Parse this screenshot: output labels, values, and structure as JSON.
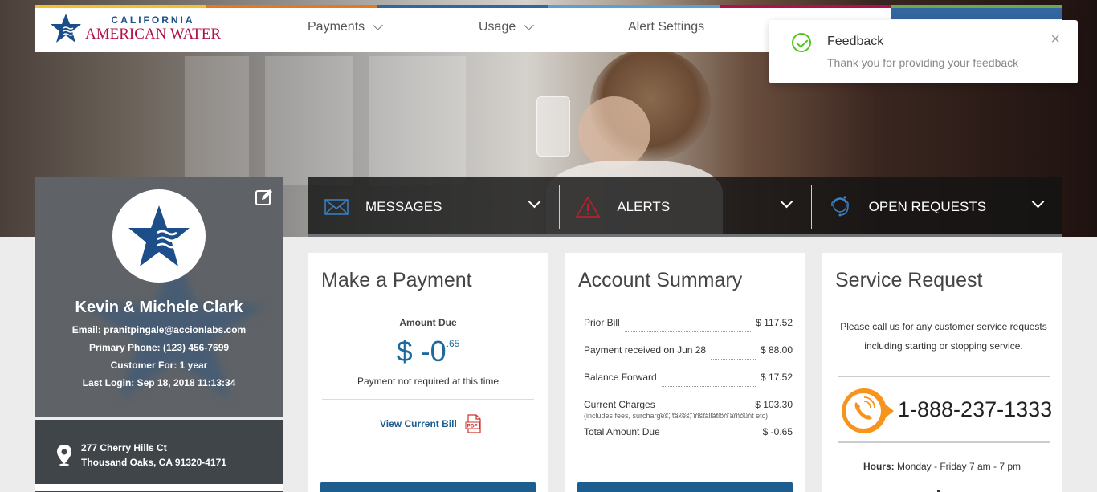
{
  "brand": {
    "line1": "CALIFORNIA",
    "line2": "AMERICAN WATER",
    "colors": [
      "#f0c030",
      "#e87722",
      "#33659e",
      "#5aa0d8",
      "#b2104a",
      "#6aa84f"
    ]
  },
  "nav": {
    "items": [
      {
        "label": "Payments",
        "has_dropdown": true
      },
      {
        "label": "Usage",
        "has_dropdown": true
      },
      {
        "label": "Alert Settings",
        "has_dropdown": false
      }
    ]
  },
  "toast": {
    "title": "Feedback",
    "message": "Thank you for providing your feedback",
    "icon": "check-circle-icon"
  },
  "profile": {
    "name": "Kevin & Michele Clark",
    "email": "Email: pranitpingale@accionlabs.com",
    "phone": "Primary Phone: (123) 456-7699",
    "customer_for": "Customer For: 1 year",
    "last_login": "Last Login: Sep 18, 2018 11:13:34",
    "address_line1": "277 Cherry Hills Ct",
    "address_line2": "Thousand Oaks, CA 91320-4171"
  },
  "strip": {
    "segments": [
      {
        "label": "MESSAGES",
        "icon": "envelope-icon"
      },
      {
        "label": "ALERTS",
        "icon": "warning-icon"
      },
      {
        "label": "OPEN REQUESTS",
        "icon": "support-agent-icon"
      }
    ]
  },
  "payment": {
    "title": "Make a Payment",
    "amount_label": "Amount Due",
    "amount_main": "$ -0",
    "amount_cents": ".65",
    "note": "Payment not required at this time",
    "view_bill": "View Current Bill"
  },
  "account": {
    "title": "Account Summary",
    "rows": [
      {
        "label": "Prior Bill",
        "value": "$ 117.52"
      },
      {
        "label": "Payment received on Jun 28",
        "value": "$ 88.00"
      },
      {
        "label": "Balance Forward",
        "value": "$ 17.52"
      },
      {
        "label": "Current Charges",
        "value": "$ 103.30"
      },
      {
        "label": "Total Amount Due",
        "value": "$ -0.65"
      }
    ],
    "charges_note": "(includes fees, surcharges, taxes, installation amount etc)"
  },
  "service": {
    "title": "Service Request",
    "text": "Please call us for any customer service requests including starting or stopping service.",
    "phone": "1-888-237-1333",
    "hours_label": "Hours:",
    "hours_value": "Monday - Friday 7 am - 7 pm"
  }
}
